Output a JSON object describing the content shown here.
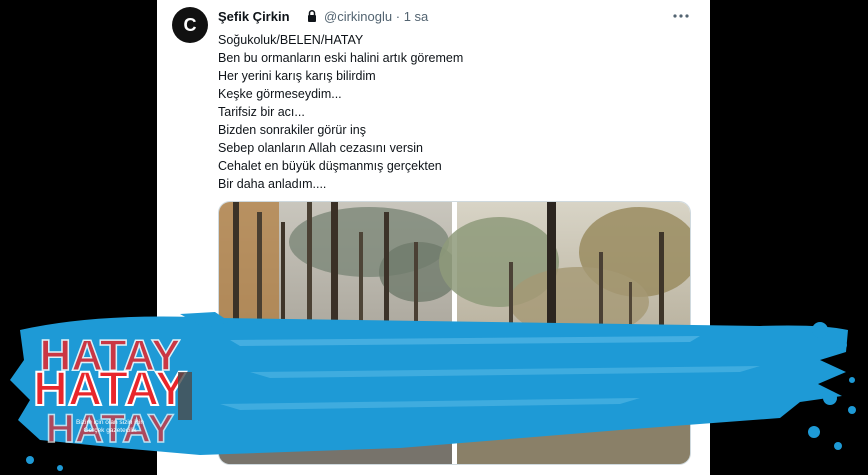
{
  "tweet": {
    "avatar_letter": "C",
    "author_name": "Şefik Çirkin",
    "handle": "@cirkinoglu",
    "separator": "·",
    "time": "1 sa",
    "lines": [
      "Soğukoluk/BELEN/HATAY",
      "Ben bu ormanların eski halini artık göremem",
      "Her yerini karış karış bilirdim",
      "Keşke görmeseydim...",
      "Tarifsiz bir acı...",
      "Bizden sonrakiler görür inş",
      "Sebep olanların Allah cezasını versin",
      "Cehalet en büyük düşmanmış gerçekten",
      "Bir daha anladım...."
    ],
    "icons": {
      "lock": "lock-icon",
      "more": "more-horizontal-icon"
    }
  },
  "watermark": {
    "brand": "HATAY",
    "tagline_1": "Bizim için olan sizin için",
    "tagline_2": "Gerçek gazetecilik",
    "colors": {
      "brand_red": "#e8262b",
      "splash_blue": "#1e9ad6"
    }
  }
}
